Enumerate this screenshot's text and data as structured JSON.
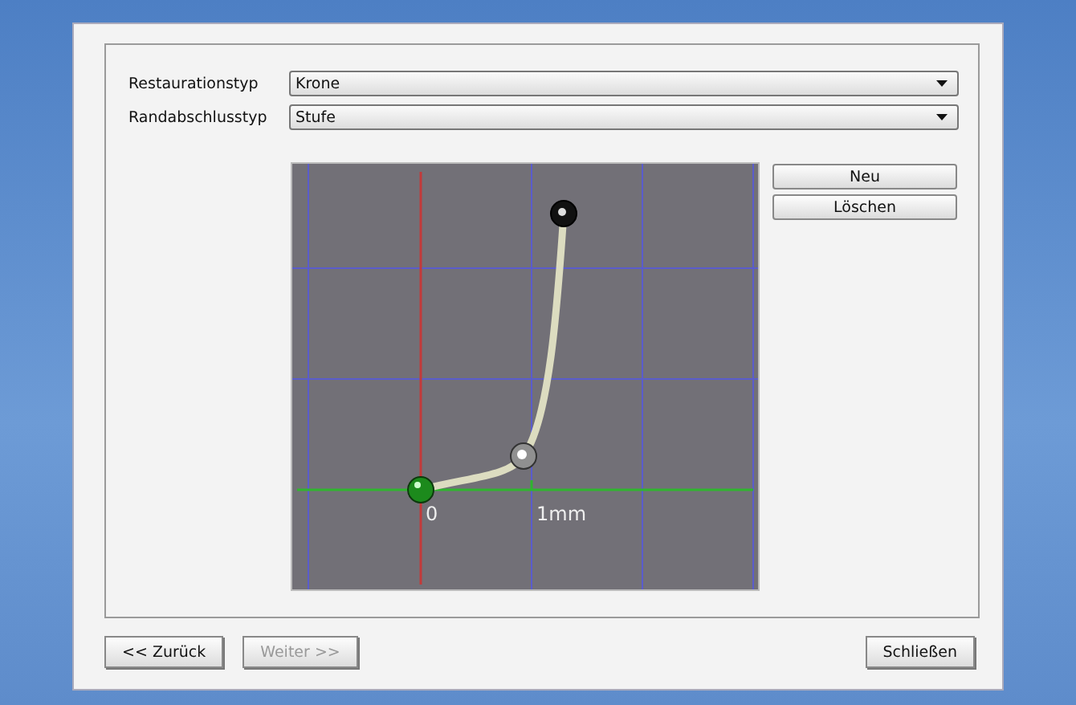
{
  "fields": [
    {
      "label": "Restaurationstyp",
      "value": "Krone"
    },
    {
      "label": "Randabschlusstyp",
      "value": "Stufe"
    }
  ],
  "canvas": {
    "axis_labels": [
      "0",
      "1mm"
    ]
  },
  "side_buttons": [
    "Neu",
    "Löschen"
  ],
  "footer_buttons": [
    {
      "label": "<< Zurück",
      "disabled": false
    },
    {
      "label": "Weiter >>",
      "disabled": true
    }
  ],
  "close_button": "Schließen"
}
